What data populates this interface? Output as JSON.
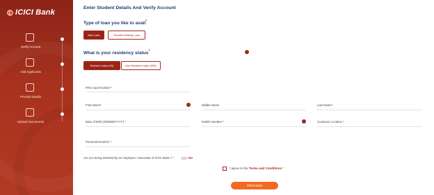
{
  "brand": {
    "name": "ICICI Bank",
    "logo_icon": "icici-logo-icon"
  },
  "sidebar": {
    "steps": [
      {
        "label": "Verify Account",
        "icon": "shield-check-icon"
      },
      {
        "label": "Add Applicants",
        "icon": "users-icon"
      },
      {
        "label": "Provide Details",
        "icon": "document-icon"
      },
      {
        "label": "Upload Documents",
        "icon": "upload-doc-icon"
      }
    ]
  },
  "main": {
    "title": "Enter Student Details And Verify Account",
    "loan_type": {
      "question": "Type of loan you like to avail",
      "required_mark": "*",
      "options": [
        "New Loan",
        "Transfer Existing Loan"
      ],
      "selected": "New Loan"
    },
    "residency": {
      "question": "What is your residency status",
      "required_mark": "*",
      "options": [
        "Resident Indian (RI)",
        "Non Resident Indian (NRI)"
      ],
      "selected": "Resident Indian (RI)"
    },
    "fields": {
      "pan": "PAN Card Number*",
      "first_name": "First Name*",
      "middle_name": "Middle Name",
      "last_name": "Last Name*",
      "dob": "Date of Birth (DD/MM/YYYY) *",
      "mobile": "Mobile Number *",
      "customer_location": "Customer Location *",
      "email": "Personal Email ID *"
    },
    "assisted_question": "Are you being assisted by an employee / associate of ICICI Bank ? *",
    "assisted_value": "No",
    "terms": {
      "prefix": "I agree to the",
      "link": "Terms and Conditions",
      "suffix": "*"
    },
    "proceed_label": "PROCEED"
  },
  "colors": {
    "primary": "#9c2416",
    "heading": "#1d3b72",
    "proceed": "#f26a21"
  }
}
